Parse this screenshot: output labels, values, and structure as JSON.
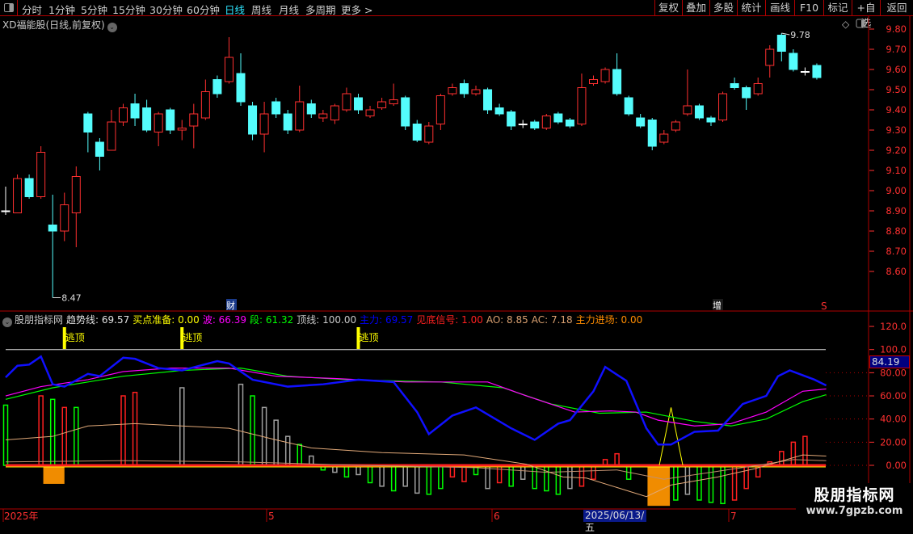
{
  "toolbar": {
    "periods": [
      "分时",
      "1分钟",
      "5分钟",
      "15分钟",
      "30分钟",
      "60分钟",
      "日线",
      "周线",
      "月线",
      "多周期",
      "更多 >"
    ],
    "active_period": "日线",
    "right_buttons": [
      "复权",
      "叠加",
      "多股",
      "统计",
      "画线",
      "F10",
      "标记",
      "+自选",
      "返回"
    ]
  },
  "stock_title": "XD福能股(日线,前复权)",
  "price_axis": [
    "9.80",
    "9.70",
    "9.60",
    "9.50",
    "9.40",
    "9.30",
    "9.20",
    "9.10",
    "9.00",
    "8.90",
    "8.80",
    "8.70",
    "8.60"
  ],
  "annotations": {
    "high": "9.78",
    "low": "8.47",
    "event_cai": "财",
    "event_zeng": "增",
    "event_s": "S"
  },
  "indicator": {
    "name": "股朋指标网",
    "legend": [
      {
        "t": "趋势线: 69.57",
        "c": "#e0e0e0"
      },
      {
        "t": "买点准备: 0.00",
        "c": "#ffff00"
      },
      {
        "t": "波: 66.39",
        "c": "#ff00ff"
      },
      {
        "t": "段: 61.32",
        "c": "#00ff00"
      },
      {
        "t": "顶线: 100.00",
        "c": "#c8c8c8"
      },
      {
        "t": "主力: 69.57",
        "c": "#0000ff"
      },
      {
        "t": "见底信号: 1.00",
        "c": "#ff2020"
      },
      {
        "t": "AO: 8.85",
        "c": "#d9a070"
      },
      {
        "t": "AC: 7.18",
        "c": "#d9a070"
      },
      {
        "t": "主力进场: 0.00",
        "c": "#ff8c00"
      }
    ],
    "signal_label": "逃顶",
    "axis": [
      "120.0",
      "100.0",
      "80.00",
      "60.00",
      "40.00",
      "20.00",
      "0.00"
    ],
    "current_value": "84.19"
  },
  "time_axis": {
    "labels": [
      "2025年",
      "5",
      "6",
      "7"
    ],
    "cursor_date": "2025/06/13/五"
  },
  "watermark": {
    "name": "股朋指标网",
    "url": "www.7gpzb.com"
  },
  "chart_data": {
    "type": "candlestick",
    "ylim": [
      8.6,
      9.8
    ],
    "candles": [
      [
        8.9,
        8.9,
        9.02,
        8.88
      ],
      [
        8.89,
        9.06,
        9.08,
        8.89
      ],
      [
        9.06,
        8.97,
        9.08,
        8.96
      ],
      [
        8.97,
        9.19,
        9.22,
        8.96
      ],
      [
        8.83,
        8.8,
        8.98,
        8.47
      ],
      [
        8.8,
        8.93,
        8.99,
        8.75
      ],
      [
        8.89,
        9.07,
        9.12,
        8.72
      ],
      [
        9.38,
        9.29,
        9.39,
        9.19
      ],
      [
        9.24,
        9.17,
        9.26,
        9.1
      ],
      [
        9.2,
        9.34,
        9.4,
        9.2
      ],
      [
        9.34,
        9.41,
        9.43,
        9.32
      ],
      [
        9.43,
        9.36,
        9.48,
        9.32
      ],
      [
        9.41,
        9.3,
        9.45,
        9.29
      ],
      [
        9.29,
        9.38,
        9.39,
        9.22
      ],
      [
        9.4,
        9.3,
        9.41,
        9.28
      ],
      [
        9.3,
        9.31,
        9.35,
        9.25
      ],
      [
        9.32,
        9.38,
        9.43,
        9.21
      ],
      [
        9.36,
        9.49,
        9.55,
        9.35
      ],
      [
        9.55,
        9.48,
        9.57,
        9.46
      ],
      [
        9.54,
        9.66,
        9.76,
        9.53
      ],
      [
        9.58,
        9.44,
        9.68,
        9.42
      ],
      [
        9.42,
        9.28,
        9.44,
        9.25
      ],
      [
        9.28,
        9.38,
        9.44,
        9.19
      ],
      [
        9.44,
        9.38,
        9.46,
        9.36
      ],
      [
        9.38,
        9.3,
        9.4,
        9.28
      ],
      [
        9.3,
        9.44,
        9.52,
        9.29
      ],
      [
        9.43,
        9.38,
        9.45,
        9.36
      ],
      [
        9.36,
        9.38,
        9.4,
        9.34
      ],
      [
        9.35,
        9.42,
        9.43,
        9.33
      ],
      [
        9.4,
        9.48,
        9.51,
        9.39
      ],
      [
        9.46,
        9.4,
        9.48,
        9.38
      ],
      [
        9.37,
        9.4,
        9.42,
        9.36
      ],
      [
        9.41,
        9.44,
        9.46,
        9.4
      ],
      [
        9.43,
        9.45,
        9.53,
        9.42
      ],
      [
        9.46,
        9.32,
        9.47,
        9.3
      ],
      [
        9.33,
        9.25,
        9.35,
        9.24
      ],
      [
        9.24,
        9.32,
        9.34,
        9.23
      ],
      [
        9.33,
        9.47,
        9.48,
        9.3
      ],
      [
        9.48,
        9.51,
        9.53,
        9.47
      ],
      [
        9.53,
        9.48,
        9.55,
        9.46
      ],
      [
        9.48,
        9.5,
        9.52,
        9.47
      ],
      [
        9.5,
        9.4,
        9.51,
        9.38
      ],
      [
        9.41,
        9.38,
        9.43,
        9.37
      ],
      [
        9.39,
        9.32,
        9.4,
        9.3
      ],
      [
        9.33,
        9.33,
        9.35,
        9.31
      ],
      [
        9.34,
        9.31,
        9.35,
        9.3
      ],
      [
        9.31,
        9.37,
        9.38,
        9.3
      ],
      [
        9.38,
        9.34,
        9.39,
        9.33
      ],
      [
        9.35,
        9.32,
        9.36,
        9.31
      ],
      [
        9.33,
        9.51,
        9.58,
        9.32
      ],
      [
        9.53,
        9.55,
        9.57,
        9.52
      ],
      [
        9.54,
        9.6,
        9.61,
        9.53
      ],
      [
        9.6,
        9.48,
        9.68,
        9.47
      ],
      [
        9.46,
        9.38,
        9.47,
        9.37
      ],
      [
        9.36,
        9.32,
        9.38,
        9.31
      ],
      [
        9.35,
        9.22,
        9.36,
        9.2
      ],
      [
        9.24,
        9.28,
        9.3,
        9.23
      ],
      [
        9.3,
        9.34,
        9.35,
        9.29
      ],
      [
        9.38,
        9.42,
        9.6,
        9.37
      ],
      [
        9.42,
        9.36,
        9.43,
        9.35
      ],
      [
        9.36,
        9.34,
        9.37,
        9.32
      ],
      [
        9.35,
        9.48,
        9.49,
        9.34
      ],
      [
        9.53,
        9.51,
        9.56,
        9.5
      ],
      [
        9.51,
        9.46,
        9.52,
        9.4
      ],
      [
        9.48,
        9.53,
        9.56,
        9.47
      ],
      [
        9.62,
        9.7,
        9.72,
        9.56
      ],
      [
        9.77,
        9.69,
        9.78,
        9.64
      ],
      [
        9.68,
        9.6,
        9.7,
        9.59
      ],
      [
        9.59,
        9.59,
        9.61,
        9.57
      ],
      [
        9.62,
        9.56,
        9.63,
        9.55
      ]
    ],
    "signals_idx": [
      5,
      15,
      30
    ],
    "series": {
      "main": [
        [
          0,
          76
        ],
        [
          1,
          86
        ],
        [
          2,
          87
        ],
        [
          3,
          94
        ],
        [
          4,
          70
        ],
        [
          5,
          68
        ],
        [
          7,
          79
        ],
        [
          8,
          77
        ],
        [
          10,
          93
        ],
        [
          11,
          92
        ],
        [
          13,
          84
        ],
        [
          15,
          82
        ],
        [
          18,
          90
        ],
        [
          19,
          88
        ],
        [
          21,
          74
        ],
        [
          24,
          68
        ],
        [
          27,
          70
        ],
        [
          30,
          74
        ],
        [
          33,
          72
        ],
        [
          35,
          46
        ],
        [
          36,
          27
        ],
        [
          38,
          43
        ],
        [
          40,
          50
        ],
        [
          43,
          32
        ],
        [
          45,
          22
        ],
        [
          47,
          36
        ],
        [
          48,
          39
        ],
        [
          50,
          64
        ],
        [
          51,
          85
        ],
        [
          52.8,
          73
        ],
        [
          54.5,
          32
        ],
        [
          55.5,
          18
        ],
        [
          56.6,
          18
        ],
        [
          58.6,
          29
        ],
        [
          60.6,
          30
        ],
        [
          62.7,
          53
        ],
        [
          64.7,
          60
        ],
        [
          65.7,
          77
        ],
        [
          66.7,
          82
        ],
        [
          68.8,
          74
        ],
        [
          69.8,
          69
        ]
      ],
      "wave": [
        [
          0,
          60
        ],
        [
          3,
          68
        ],
        [
          7,
          74
        ],
        [
          10,
          81
        ],
        [
          14,
          84
        ],
        [
          19,
          84
        ],
        [
          23,
          77
        ],
        [
          28,
          75
        ],
        [
          34,
          72
        ],
        [
          38,
          72
        ],
        [
          41,
          72
        ],
        [
          44.3,
          60
        ],
        [
          48.4,
          46
        ],
        [
          51.5,
          47
        ],
        [
          53.6,
          46
        ],
        [
          55.5,
          39
        ],
        [
          58.6,
          34
        ],
        [
          61.7,
          36
        ],
        [
          64.7,
          46
        ],
        [
          67.8,
          64
        ],
        [
          69.8,
          66
        ]
      ],
      "segment": [
        [
          0,
          57
        ],
        [
          4,
          67
        ],
        [
          10,
          77
        ],
        [
          15,
          82
        ],
        [
          20,
          84
        ],
        [
          24,
          77
        ],
        [
          29,
          74
        ],
        [
          37,
          72
        ],
        [
          42.3,
          67
        ],
        [
          46.4,
          53
        ],
        [
          50.5,
          45
        ],
        [
          54.5,
          46
        ],
        [
          58.6,
          38
        ],
        [
          61.7,
          34
        ],
        [
          64.7,
          40
        ],
        [
          67.8,
          55
        ],
        [
          69.8,
          61
        ]
      ],
      "ao": [
        [
          0,
          22
        ],
        [
          4,
          25
        ],
        [
          7,
          34
        ],
        [
          11,
          36
        ],
        [
          19,
          32
        ],
        [
          23,
          22
        ],
        [
          26,
          15
        ],
        [
          32,
          11
        ],
        [
          39,
          9
        ],
        [
          44.3,
          1
        ],
        [
          47.4,
          -10
        ],
        [
          49.4,
          -11
        ],
        [
          54.5,
          -27
        ],
        [
          56.6,
          -17
        ],
        [
          60.6,
          -10
        ],
        [
          63.7,
          -3
        ],
        [
          67.8,
          9
        ],
        [
          69.8,
          8
        ]
      ],
      "ac": [
        [
          0,
          3
        ],
        [
          10,
          4
        ],
        [
          20,
          3
        ],
        [
          30,
          0
        ],
        [
          40,
          -2
        ],
        [
          46,
          -6
        ],
        [
          52,
          -4
        ],
        [
          56,
          -12
        ],
        [
          60,
          -6
        ],
        [
          64,
          0
        ],
        [
          67,
          5
        ],
        [
          69.8,
          4
        ]
      ],
      "hist": [
        [
          0,
          52,
          "g"
        ],
        [
          3,
          60,
          "r"
        ],
        [
          4,
          57,
          "g"
        ],
        [
          5,
          50,
          "r"
        ],
        [
          6,
          50,
          "g"
        ],
        [
          10,
          60,
          "r"
        ],
        [
          11,
          63,
          "r"
        ],
        [
          15,
          67,
          "w"
        ],
        [
          20,
          70,
          "w"
        ],
        [
          21,
          60,
          "g"
        ],
        [
          22,
          50,
          "w"
        ],
        [
          23,
          39,
          "w"
        ],
        [
          24,
          25,
          "w"
        ],
        [
          25,
          18,
          "g"
        ],
        [
          26,
          8,
          "w"
        ],
        [
          27,
          -4,
          "g"
        ],
        [
          28,
          -6,
          "w"
        ],
        [
          29,
          -10,
          "g"
        ],
        [
          30,
          -8,
          "w"
        ],
        [
          31,
          -15,
          "g"
        ],
        [
          32,
          -18,
          "w"
        ],
        [
          33,
          -22,
          "g"
        ],
        [
          34,
          -18,
          "w"
        ],
        [
          35,
          -24,
          "w"
        ],
        [
          36,
          -25,
          "g"
        ],
        [
          37,
          -20,
          "g"
        ],
        [
          38,
          -10,
          "r"
        ],
        [
          39,
          -14,
          "r"
        ],
        [
          40,
          -8,
          "g"
        ],
        [
          41,
          -20,
          "w"
        ],
        [
          42,
          -15,
          "r"
        ],
        [
          43,
          -18,
          "g"
        ],
        [
          44,
          -12,
          "w"
        ],
        [
          45,
          -20,
          "g"
        ],
        [
          46,
          -22,
          "g"
        ],
        [
          47,
          -25,
          "g"
        ],
        [
          48,
          -20,
          "w"
        ],
        [
          49,
          -18,
          "r"
        ],
        [
          50,
          -12,
          "r"
        ],
        [
          51,
          5,
          "r"
        ],
        [
          52,
          10,
          "r"
        ],
        [
          53,
          -12,
          "g"
        ],
        [
          55,
          -10,
          "g"
        ],
        [
          56,
          -20,
          "w"
        ],
        [
          57,
          -30,
          "g"
        ],
        [
          58,
          -25,
          "w"
        ],
        [
          59,
          -30,
          "g"
        ],
        [
          60,
          -32,
          "g"
        ],
        [
          61,
          -33,
          "g"
        ],
        [
          62,
          -30,
          "r"
        ],
        [
          63,
          -20,
          "r"
        ],
        [
          64,
          -10,
          "r"
        ],
        [
          65,
          3,
          "r"
        ],
        [
          66,
          12,
          "r"
        ],
        [
          67,
          20,
          "r"
        ],
        [
          68,
          25,
          "r"
        ]
      ],
      "entry_blocks": [
        [
          3.2,
          5.0,
          -16
        ],
        [
          54.6,
          56.5,
          -35
        ]
      ],
      "bottom_signal_idx": 56.6
    }
  }
}
